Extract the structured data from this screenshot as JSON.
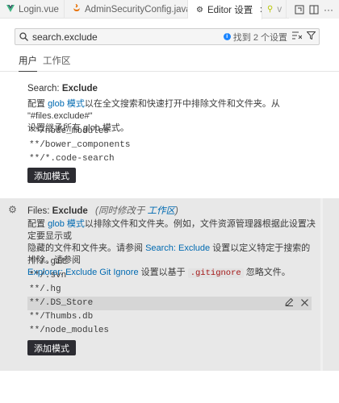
{
  "tabs": [
    {
      "icon": "vue-icon",
      "label": "Login.vue",
      "color": "#41b883"
    },
    {
      "icon": "java-icon",
      "label": "AdminSecurityConfig.java",
      "color": "#e76f00"
    },
    {
      "icon": "settings-icon",
      "label": "Editor 设置",
      "active": true,
      "close": "✕"
    },
    {
      "icon": "vue-icon",
      "label": "v"
    }
  ],
  "search": {
    "value": "search.exclude",
    "found": "找到 2 个设置"
  },
  "scope_tabs": {
    "user": "用户",
    "workspace": "工作区"
  },
  "search_exclude": {
    "category": "Search: ",
    "name": "Exclude",
    "desc_1": "配置 ",
    "desc_link": "glob 模式",
    "desc_2": "以在全文搜索和快速打开中排除文件和文件夹。从 \"#files.exclude#\"",
    "desc_3": "设置继承所有 glob 模式。",
    "items": [
      "**/node_modules",
      "**/bower_components",
      "**/*.code-search"
    ],
    "add_button": "添加模式"
  },
  "files_exclude": {
    "category": "Files: ",
    "name": "Exclude",
    "modified_prefix": "(同时修改于 ",
    "modified_link": "工作区",
    "modified_suffix": ")",
    "desc_1": "配置 ",
    "desc_link": "glob 模式",
    "desc_2": "以排除文件和文件夹。例如，文件资源管理器根据此设置决定要显示或",
    "desc_3": "隐藏的文件和文件夹。请参阅 ",
    "desc_link2": "Search: Exclude",
    "desc_4": " 设置以定义特定于搜索的排除。请参阅",
    "desc_link3": "Explorer: Exclude Git Ignore",
    "desc_5": " 设置以基于 ",
    "desc_code": ".gitignore",
    "desc_6": " 忽略文件。",
    "items": [
      "**/.git",
      "**/.svn",
      "**/.hg",
      "**/.DS_Store",
      "**/Thumbs.db",
      "**/node_modules"
    ],
    "selected_index": 3,
    "add_button": "添加模式"
  },
  "colors": {
    "accent_link": "#006ab1",
    "button_bg": "#2c2c32"
  }
}
